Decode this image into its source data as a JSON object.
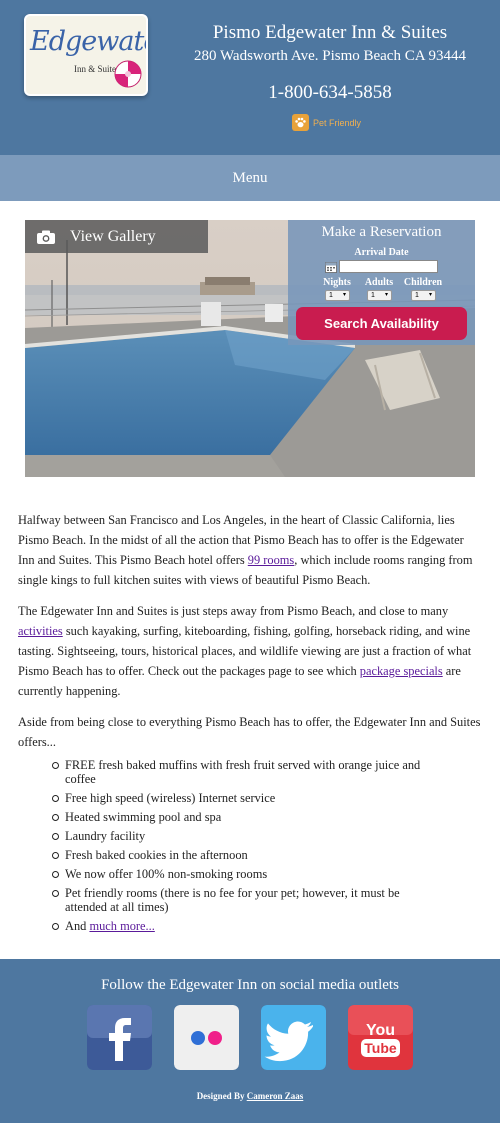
{
  "header": {
    "hotel_name": "Pismo Edgewater Inn & Suites",
    "address": "280 Wadsworth Ave. Pismo Beach CA 93444",
    "phone": "1-800-634-5858",
    "pet_label": "Pet Friendly",
    "logo_word": "Edgewater",
    "logo_sub": "Inn & Suites"
  },
  "menu": {
    "label": "Menu"
  },
  "hero": {
    "gallery_label": "View Gallery",
    "reservation": {
      "title": "Make a Reservation",
      "arrival_label": "Arrival Date",
      "arrival_value": "",
      "nights_label": "Nights",
      "adults_label": "Adults",
      "children_label": "Children",
      "nights_value": "1",
      "adults_value": "1",
      "children_value": "1",
      "button_label": "Search Availability"
    }
  },
  "content": {
    "p1_a": "Halfway between San Francisco and Los Angeles, in the heart of Classic California, lies Pismo Beach. In the midst of all the action that Pismo Beach has to offer is the Edgewater Inn and Suites. This Pismo Beach hotel offers ",
    "p1_link": "99 rooms",
    "p1_b": ", which include rooms ranging from single kings to full kitchen suites with views of beautiful Pismo Beach.",
    "p2_a": "The Edgewater Inn and Suites is just steps away from Pismo Beach, and close to many ",
    "p2_link1": "activities",
    "p2_b": " such kayaking, surfing, kiteboarding, fishing, golfing, horseback riding, and wine tasting. Sightseeing, tours, historical places, and wildlife viewing are just a fraction of what Pismo Beach has to offer. Check out the packages page to see which ",
    "p2_link2": "package specials",
    "p2_c": " are currently happening.",
    "p3": "Aside from being close to everything Pismo Beach has to offer, the Edgewater Inn and Suites offers...",
    "amenities": [
      "FREE fresh baked muffins with fresh fruit served with orange juice and coffee",
      "Free high speed (wireless) Internet service",
      "Heated swimming pool and spa",
      "Laundry facility",
      "Fresh baked cookies in the afternoon",
      "We now offer 100% non-smoking rooms",
      "Pet friendly rooms (there is no fee for your pet; however, it must be attended at all times)"
    ],
    "last_item_prefix": "And ",
    "last_item_link": "much more..."
  },
  "footer": {
    "follow": "Follow the Edgewater Inn on social media outlets",
    "designed_prefix": "Designed By ",
    "designed_link": "Cameron Zaas",
    "youtube_top": "You",
    "youtube_bottom": "Tube"
  },
  "colors": {
    "header_bg": "#4e77a0",
    "menu_bg": "#7d9bbc",
    "search_button": "#c91c4f",
    "link": "#5a1a9a"
  }
}
